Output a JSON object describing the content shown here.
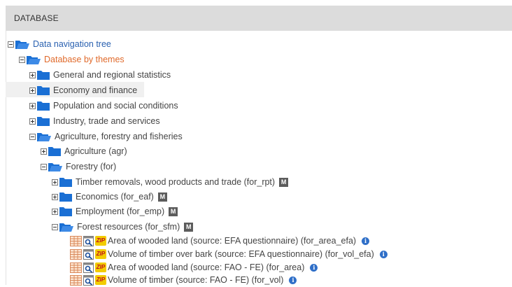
{
  "header": {
    "title": "DATABASE"
  },
  "tree": {
    "root": {
      "label": "Data navigation tree"
    },
    "themes": {
      "label": "Database by themes"
    },
    "general": {
      "label": "General and regional statistics"
    },
    "economy": {
      "label": "Economy and finance"
    },
    "population": {
      "label": "Population and social conditions"
    },
    "industry": {
      "label": "Industry, trade and services"
    },
    "agri_forestry": {
      "label": "Agriculture, forestry and fisheries"
    },
    "agriculture": {
      "label": "Agriculture (agr)"
    },
    "forestry": {
      "label": "Forestry (for)"
    },
    "timber": {
      "label": "Timber removals, wood products and trade (for_rpt)",
      "badge": "M"
    },
    "economics": {
      "label": "Economics (for_eaf)",
      "badge": "M"
    },
    "employment": {
      "label": "Employment (for_emp)",
      "badge": "M"
    },
    "forest_resources": {
      "label": "Forest resources (for_sfm)",
      "badge": "M"
    },
    "datasets": [
      {
        "label": "Area of wooded land (source: EFA questionnaire) (for_area_efa)",
        "zip": "ZIP",
        "info": "i"
      },
      {
        "label": "Volume of timber over bark (source: EFA questionnaire) (for_vol_efa)",
        "zip": "ZIP",
        "info": "i"
      },
      {
        "label": "Area of wooded land (source: FAO - FE) (for_area)",
        "zip": "ZIP",
        "info": "i"
      },
      {
        "label": "Volume of timber (source: FAO - FE) (for_vol)",
        "zip": "ZIP",
        "info": "i"
      }
    ]
  },
  "colors": {
    "link": "#2a61b0",
    "active": "#e06a2b",
    "folder": "#1a6fd4",
    "header_bg": "#dcdcdc",
    "info": "#2f6fc8",
    "zip_bg": "#f2cc00"
  },
  "icons": [
    "folder-open-icon",
    "folder-closed-icon",
    "expand-icon",
    "collapse-icon",
    "table-icon",
    "data-explorer-icon",
    "zip-icon",
    "info-icon",
    "metadata-icon"
  ]
}
